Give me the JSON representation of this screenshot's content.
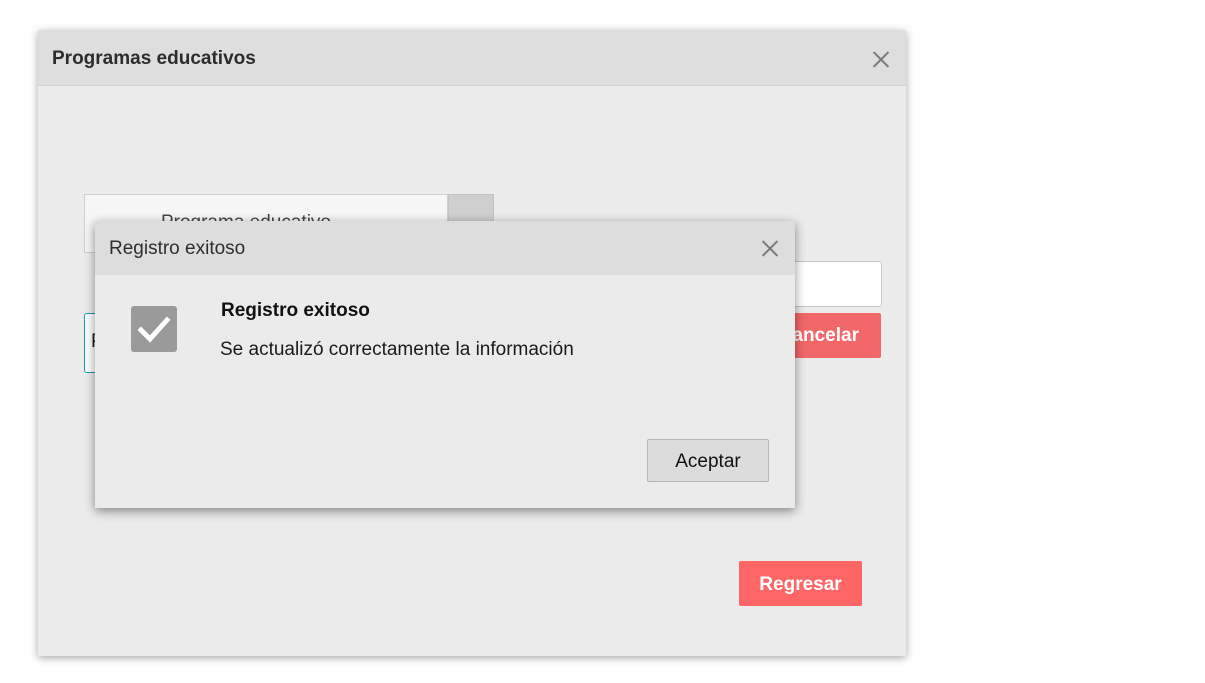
{
  "window": {
    "title": "Programas educativos",
    "close_icon": "close-icon"
  },
  "form": {
    "program_select_label": "Programa educativo",
    "program_input_value": "P",
    "cancel_label": "Cancelar"
  },
  "footer": {
    "back_label": "Regresar"
  },
  "modal": {
    "title": "Registro exitoso",
    "message_title": "Registro exitoso",
    "message_body": "Se actualizó correctamente la información",
    "accept_label": "Aceptar",
    "status_icon": "check-icon"
  },
  "colors": {
    "danger": "#fe6565",
    "accent_border": "#1e9bb5",
    "header_bg": "#dedede"
  }
}
